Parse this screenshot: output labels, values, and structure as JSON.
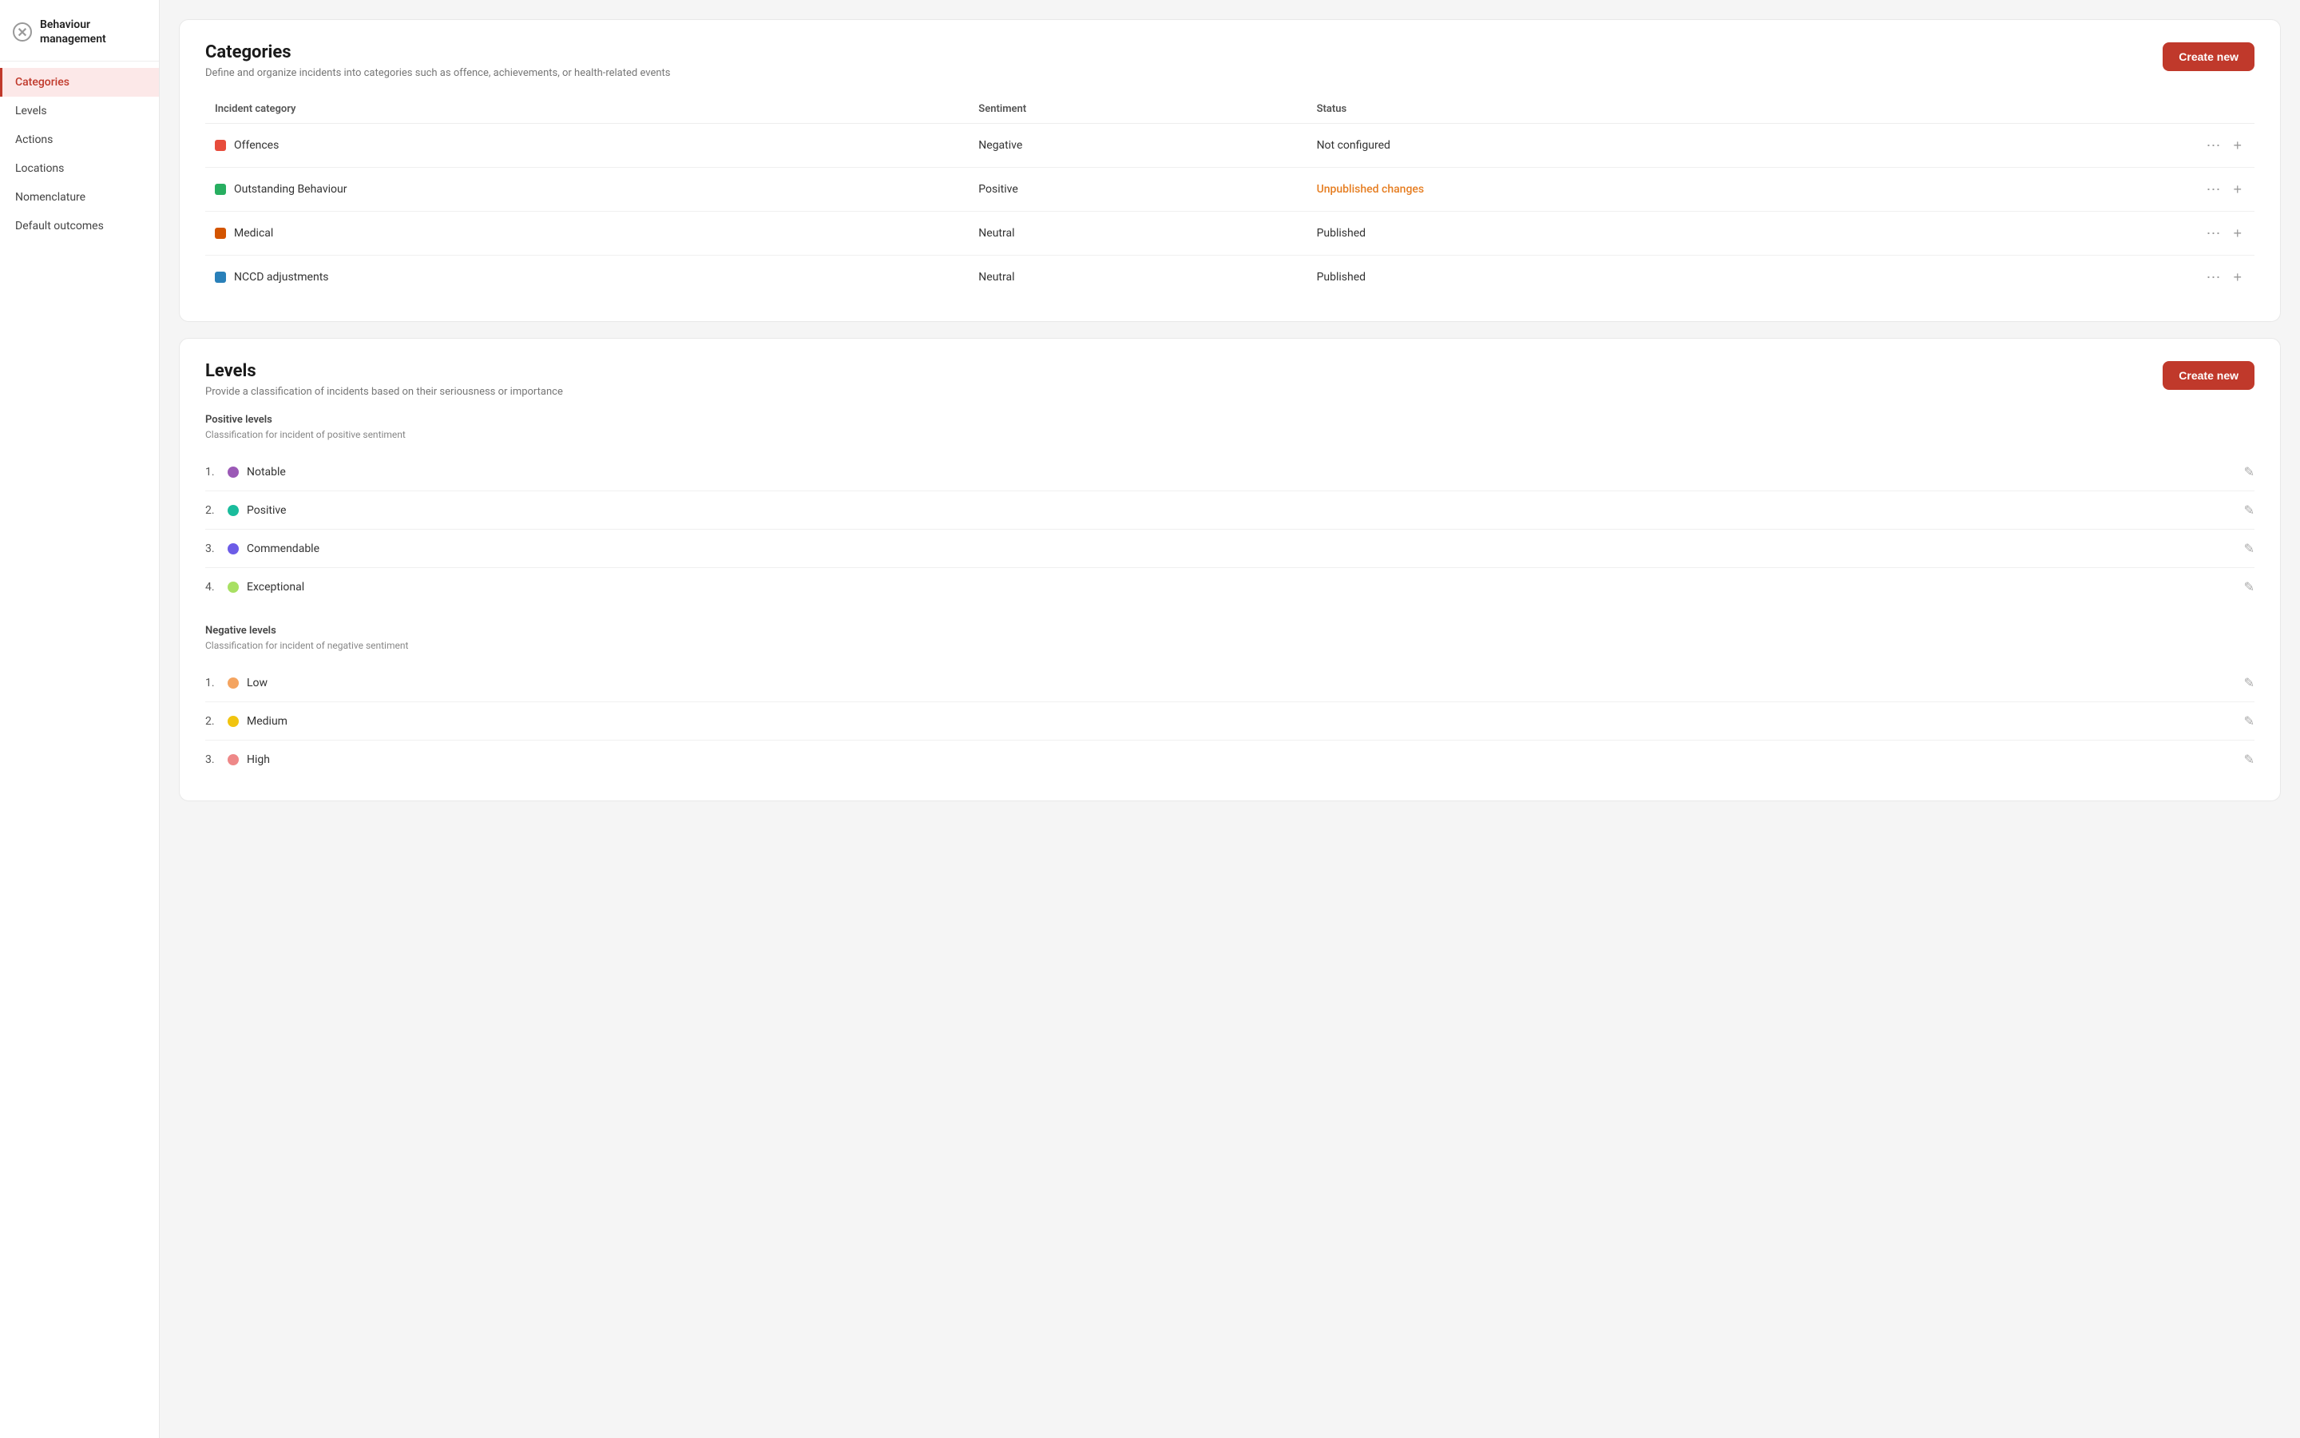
{
  "sidebar": {
    "header": {
      "title": "Behaviour management",
      "icon": "×"
    },
    "items": [
      {
        "id": "categories",
        "label": "Categories",
        "active": true
      },
      {
        "id": "levels",
        "label": "Levels",
        "active": false
      },
      {
        "id": "actions",
        "label": "Actions",
        "active": false
      },
      {
        "id": "locations",
        "label": "Locations",
        "active": false
      },
      {
        "id": "nomenclature",
        "label": "Nomenclature",
        "active": false
      },
      {
        "id": "default-outcomes",
        "label": "Default outcomes",
        "active": false
      }
    ]
  },
  "categories": {
    "title": "Categories",
    "subtitle": "Define and organize incidents into categories such as offence, achievements, or health-related events",
    "create_btn": "Create new",
    "columns": {
      "incident_category": "Incident category",
      "sentiment": "Sentiment",
      "status": "Status"
    },
    "rows": [
      {
        "name": "Offences",
        "color": "#e74c3c",
        "sentiment": "Negative",
        "status": "Not configured",
        "status_type": "not-configured"
      },
      {
        "name": "Outstanding Behaviour",
        "color": "#27ae60",
        "sentiment": "Positive",
        "status": "Unpublished changes",
        "status_type": "unpublished"
      },
      {
        "name": "Medical",
        "color": "#d35400",
        "sentiment": "Neutral",
        "status": "Published",
        "status_type": "published"
      },
      {
        "name": "NCCD adjustments",
        "color": "#2980b9",
        "sentiment": "Neutral",
        "status": "Published",
        "status_type": "published"
      }
    ]
  },
  "levels": {
    "title": "Levels",
    "subtitle": "Provide a classification of incidents based on their seriousness or importance",
    "create_btn": "Create new",
    "positive": {
      "label": "Positive levels",
      "description": "Classification for incident of positive sentiment",
      "items": [
        {
          "num": "1.",
          "name": "Notable",
          "color": "#9b59b6"
        },
        {
          "num": "2.",
          "name": "Positive",
          "color": "#1abc9c"
        },
        {
          "num": "3.",
          "name": "Commendable",
          "color": "#6c5ce7"
        },
        {
          "num": "4.",
          "name": "Exceptional",
          "color": "#a8e063"
        }
      ]
    },
    "negative": {
      "label": "Negative levels",
      "description": "Classification for incident of negative sentiment",
      "items": [
        {
          "num": "1.",
          "name": "Low",
          "color": "#f4a460"
        },
        {
          "num": "2.",
          "name": "Medium",
          "color": "#f1c40f"
        },
        {
          "num": "3.",
          "name": "High",
          "color": "#e88"
        }
      ]
    }
  }
}
